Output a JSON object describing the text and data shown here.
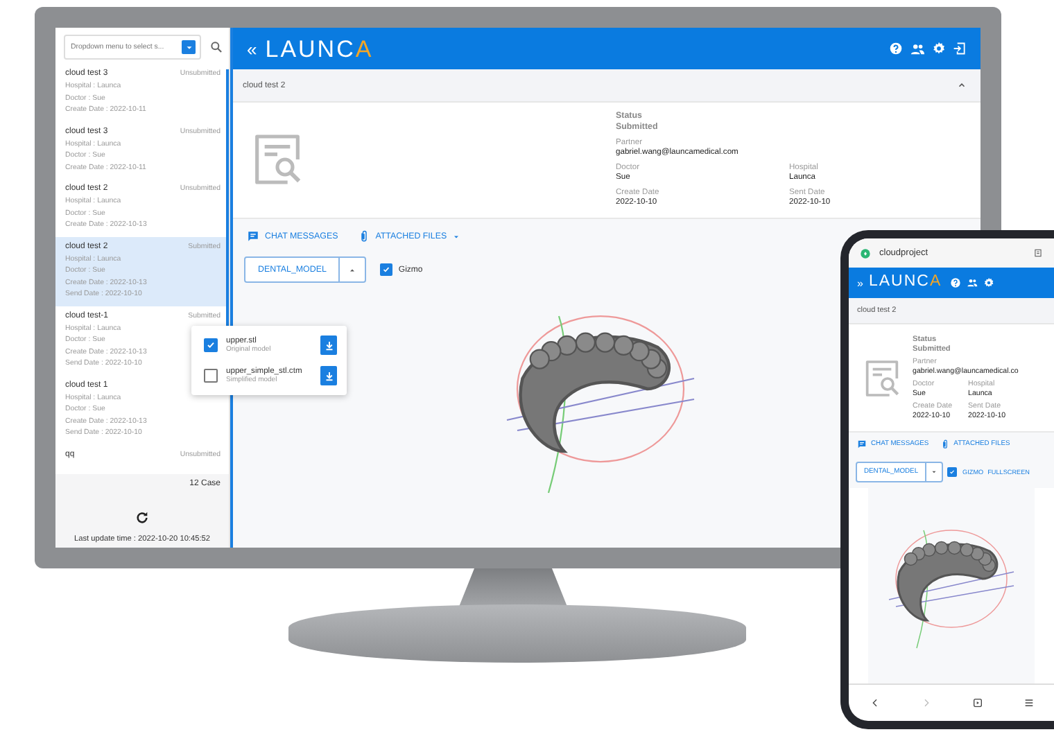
{
  "sidebar": {
    "dropdown": {
      "placeholder": "Dropdown menu to select s..."
    },
    "cases": [
      {
        "title": "cloud test 3",
        "status": "Unsubmitted",
        "selected": false,
        "lines": [
          "Hospital : Launca",
          "Doctor : Sue",
          "Create Date : 2022-10-11"
        ]
      },
      {
        "title": "cloud test 3",
        "status": "Unsubmitted",
        "selected": false,
        "lines": [
          "Hospital : Launca",
          "Doctor : Sue",
          "Create Date : 2022-10-11"
        ]
      },
      {
        "title": "cloud test 2",
        "status": "Unsubmitted",
        "selected": false,
        "lines": [
          "Hospital : Launca",
          "Doctor : Sue",
          "Create Date : 2022-10-13"
        ]
      },
      {
        "title": "cloud test 2",
        "status": "Submitted",
        "selected": true,
        "lines": [
          "Hospital : Launca",
          "Doctor : Sue",
          "Create Date : 2022-10-13",
          "Send Date : 2022-10-10"
        ]
      },
      {
        "title": "cloud test-1",
        "status": "Submitted",
        "selected": false,
        "lines": [
          "Hospital : Launca",
          "Doctor : Sue",
          "Create Date : 2022-10-13",
          "Send Date : 2022-10-10"
        ]
      },
      {
        "title": "cloud test 1",
        "selected": false,
        "lines": [
          "Hospital : Launca",
          "Doctor : Sue",
          "Create Date : 2022-10-13",
          "Send Date : 2022-10-10"
        ]
      },
      {
        "title": "qq",
        "status": "Unsubmitted",
        "selected": false
      }
    ],
    "case_count": "12 Case",
    "last_update": "Last update time : 2022-10-20 10:45:52"
  },
  "header": {
    "collapse": "«",
    "logo": "LAUNCA"
  },
  "case_bar": {
    "title": "cloud test 2",
    "expanded": true
  },
  "details": [
    {
      "kind": "wide",
      "label": "Status",
      "value": "Submitted"
    },
    {
      "kind": "wide",
      "label": "Partner",
      "value": "gabriel.wang@launcamedical.com"
    },
    {
      "kind": "half",
      "label": "Doctor",
      "value": "Sue"
    },
    {
      "kind": "half",
      "label": "Hospital",
      "value": "Launca"
    },
    {
      "kind": "half",
      "label": "Create Date",
      "value": "2022-10-10"
    },
    {
      "kind": "half",
      "label": "Sent Date",
      "value": "2022-10-10"
    }
  ],
  "tabs": [
    {
      "label": "CHAT MESSAGES",
      "dropdown": false
    },
    {
      "label": "ATTACHED FILES",
      "dropdown": true
    }
  ],
  "viewer": {
    "model_button": "DENTAL_MODEL",
    "menu_open": true,
    "gizmo": {
      "label": "Gizmo",
      "checked": true
    }
  },
  "file_menu": [
    {
      "name": "upper.stl",
      "note": "Original model",
      "checked": true
    },
    {
      "name": "upper_simple_stl.ctm",
      "note": "Simplified model",
      "checked": false
    }
  ],
  "phone": {
    "url": "cloudproject",
    "header": {
      "expand": "»",
      "logo": "LAUNCA"
    },
    "case_title": "cloud test 2",
    "details": [
      {
        "kind": "wide",
        "label": "Status",
        "value": "Submitted"
      },
      {
        "kind": "wide",
        "label": "Partner",
        "value": "gabriel.wang@launcamedical.co"
      },
      {
        "kind": "half",
        "label": "Doctor",
        "value": "Sue"
      },
      {
        "kind": "half",
        "label": "Hospital",
        "value": "Launca"
      },
      {
        "kind": "half",
        "label": "Create Date",
        "value": "2022-10-10"
      },
      {
        "kind": "half",
        "label": "Sent Date",
        "value": "2022-10-10"
      }
    ],
    "tabs": [
      {
        "label": "CHAT MESSAGES"
      },
      {
        "label": "ATTACHED FILES"
      }
    ],
    "model_button": "DENTAL_MODEL",
    "menu_open": false,
    "gizmo": {
      "label": "GIZMO",
      "checked": true
    },
    "fullscreen": "FULLSCREEN"
  }
}
